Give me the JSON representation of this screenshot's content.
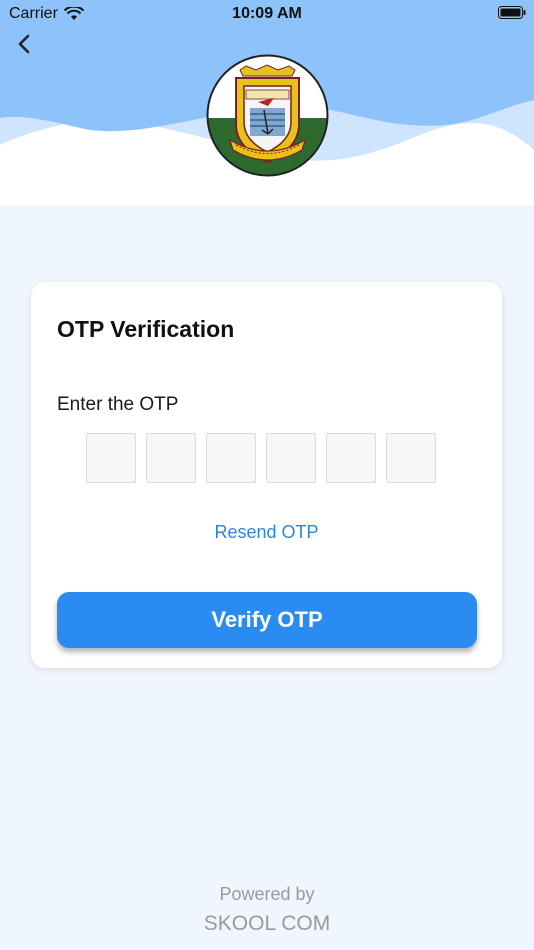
{
  "status_bar": {
    "carrier": "Carrier",
    "time": "10:09 AM"
  },
  "header": {
    "back_icon": "chevron-left-icon",
    "logo": {
      "alt": "School crest logo"
    },
    "colors": {
      "sky": "#8ec2fb",
      "wave_light": "#cfe4fd",
      "wave_white": "#ffffff"
    }
  },
  "card": {
    "title": "OTP Verification",
    "otp_label": "Enter the OTP",
    "otp_digits": [
      "",
      "",
      "",
      "",
      "",
      ""
    ],
    "resend_label": "Resend OTP",
    "verify_label": "Verify OTP"
  },
  "footer": {
    "powered_by": "Powered by",
    "brand": "SKOOL COM"
  },
  "colors": {
    "accent": "#2a8cf0",
    "link": "#2b86d9",
    "background": "#f0f6fd"
  }
}
